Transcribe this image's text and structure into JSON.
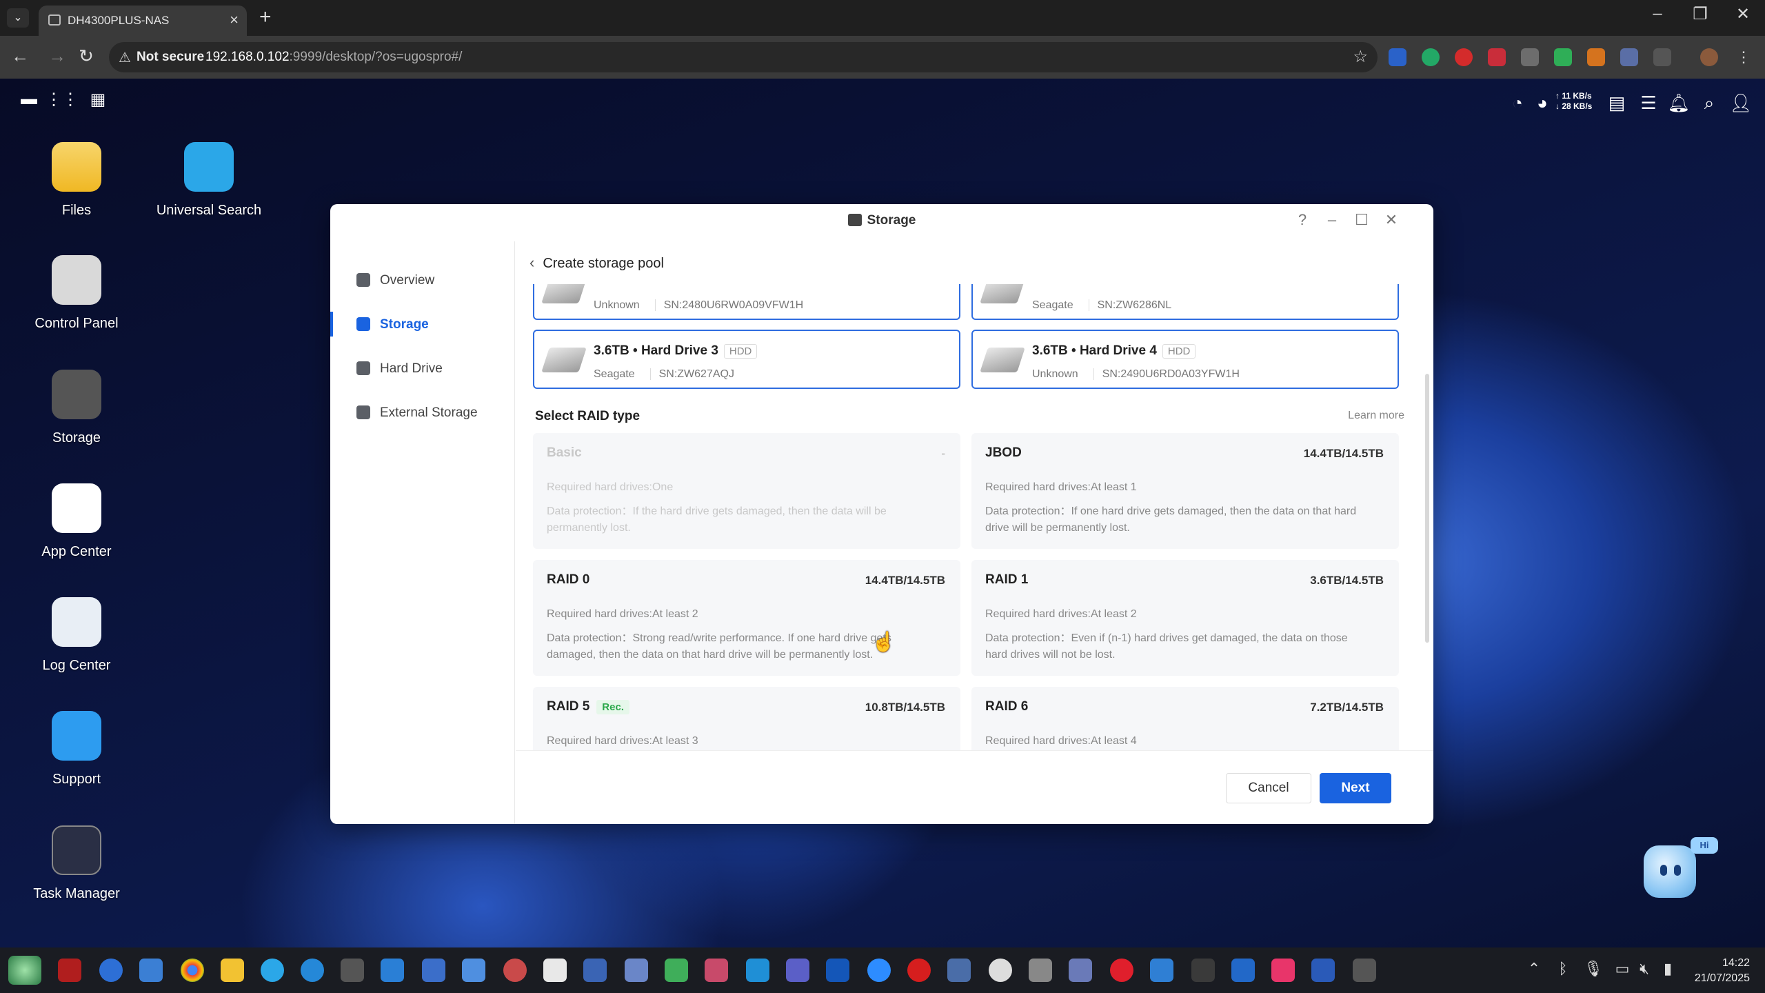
{
  "browser": {
    "tab_title": "DH4300PLUS-NAS",
    "new_tab_label": "+",
    "security_label": "Not secure",
    "url_host": "192.168.0.102",
    "url_rest": ":9999/desktop/?os=ugospro#/"
  },
  "os_topbar": {
    "upload_speed": "↑ 11 KB/s",
    "download_speed": "↓ 28 KB/s"
  },
  "desktop_icons": [
    {
      "label": "Files",
      "color": "#f2c232"
    },
    {
      "label": "Universal Search",
      "color": "#2ba7e8"
    },
    {
      "label": "Control Panel",
      "color": "#dcdcdc"
    },
    {
      "label": "Storage",
      "color": "#5a5a5a"
    },
    {
      "label": "App Center",
      "color": "#ffffff"
    },
    {
      "label": "Log Center",
      "color": "#e8eef5"
    },
    {
      "label": "Support",
      "color": "#2d9cf0"
    },
    {
      "label": "Task Manager",
      "color": "#2a2f45"
    }
  ],
  "window": {
    "title": "Storage",
    "help_label": "?",
    "sidebar": [
      {
        "label": "Overview",
        "active": false
      },
      {
        "label": "Storage",
        "active": true
      },
      {
        "label": "Hard Drive",
        "active": false
      },
      {
        "label": "External Storage",
        "active": false
      }
    ],
    "breadcrumb": "Create storage pool",
    "drives": [
      {
        "name": "",
        "type": "",
        "vendor": "Unknown",
        "sn": "SN:2480U6RW0A09VFW1H"
      },
      {
        "name": "",
        "type": "",
        "vendor": "Seagate",
        "sn": "SN:ZW6286NL"
      },
      {
        "name": "3.6TB • Hard Drive 3",
        "type": "HDD",
        "vendor": "Seagate",
        "sn": "SN:ZW627AQJ"
      },
      {
        "name": "3.6TB • Hard Drive 4",
        "type": "HDD",
        "vendor": "Unknown",
        "sn": "SN:2490U6RD0A03YFW1H"
      }
    ],
    "raid_section_title": "Select RAID type",
    "learn_more": "Learn more",
    "raid_types": [
      {
        "name": "Basic",
        "capacity": "-",
        "required": "Required hard drives:One",
        "protection": "Data protection：If the hard drive gets damaged, then the data will be permanently lost.",
        "disabled": true,
        "recommended": false
      },
      {
        "name": "JBOD",
        "capacity": "14.4TB/14.5TB",
        "required": "Required hard drives:At least 1",
        "protection": "Data protection：If one hard drive gets damaged, then the data on that hard drive will be permanently lost.",
        "disabled": false,
        "recommended": false
      },
      {
        "name": "RAID 0",
        "capacity": "14.4TB/14.5TB",
        "required": "Required hard drives:At least 2",
        "protection": "Data protection：Strong read/write performance. If one hard drive gets damaged, then the data on that hard drive will be permanently lost.",
        "disabled": false,
        "recommended": false
      },
      {
        "name": "RAID 1",
        "capacity": "3.6TB/14.5TB",
        "required": "Required hard drives:At least 2",
        "protection": "Data protection：Even if (n-1) hard drives get damaged, the data on those hard drives will not be lost.",
        "disabled": false,
        "recommended": false
      },
      {
        "name": "RAID 5",
        "capacity": "10.8TB/14.5TB",
        "required": "Required hard drives:At least 3",
        "protection": "",
        "disabled": false,
        "recommended": true,
        "rec_label": "Rec."
      },
      {
        "name": "RAID 6",
        "capacity": "7.2TB/14.5TB",
        "required": "Required hard drives:At least 4",
        "protection": "",
        "disabled": false,
        "recommended": false
      }
    ],
    "cancel_label": "Cancel",
    "next_label": "Next"
  },
  "assistant_bubble": "Hi",
  "taskbar": {
    "time": "14:22",
    "date": "21/07/2025"
  },
  "accent_color": "#1a63e0"
}
